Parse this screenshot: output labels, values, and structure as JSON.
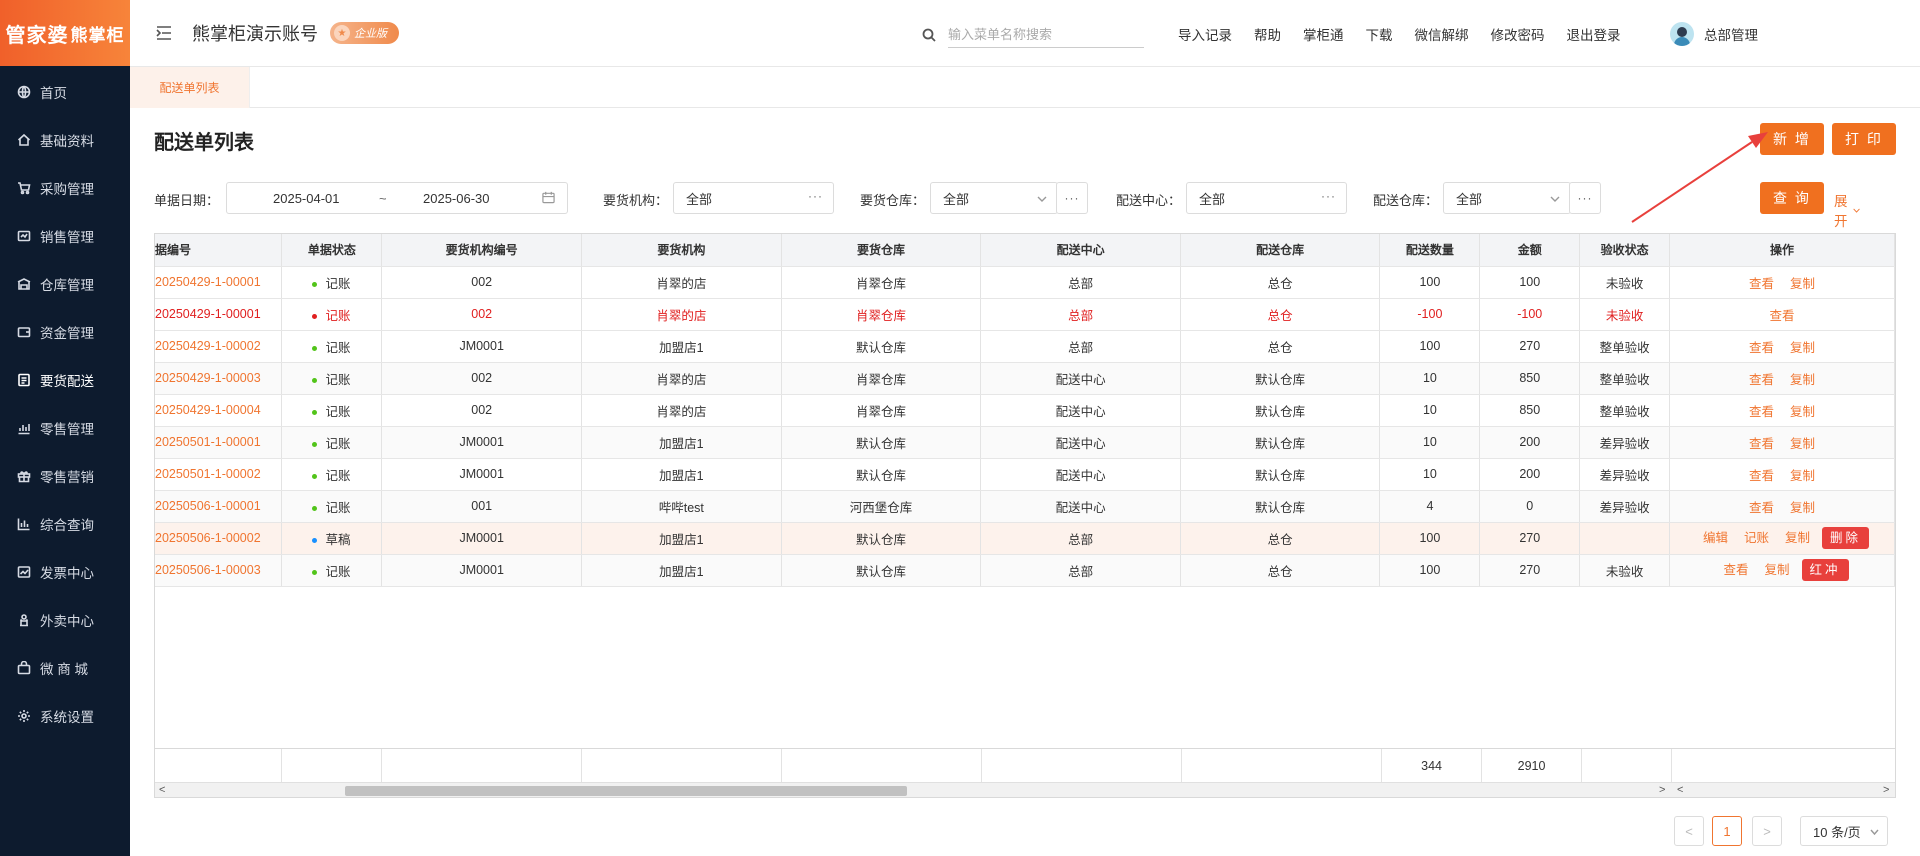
{
  "logo": {
    "text_a": "管家婆",
    "text_b": "熊掌柜"
  },
  "sidebar": {
    "items": [
      {
        "label": "首页",
        "icon": "globe-icon"
      },
      {
        "label": "基础资料",
        "icon": "home-icon"
      },
      {
        "label": "采购管理",
        "icon": "cart-icon"
      },
      {
        "label": "销售管理",
        "icon": "sales-icon"
      },
      {
        "label": "仓库管理",
        "icon": "warehouse-icon"
      },
      {
        "label": "资金管理",
        "icon": "wallet-icon"
      },
      {
        "label": "要货配送",
        "icon": "list-icon"
      },
      {
        "label": "零售管理",
        "icon": "chart-icon"
      },
      {
        "label": "零售营销",
        "icon": "gift-icon"
      },
      {
        "label": "综合查询",
        "icon": "bar-chart-icon"
      },
      {
        "label": "发票中心",
        "icon": "trend-icon"
      },
      {
        "label": "外卖中心",
        "icon": "bike-icon"
      },
      {
        "label": "微 商 城",
        "icon": "bag-icon"
      },
      {
        "label": "系统设置",
        "icon": "gear-icon"
      }
    ]
  },
  "header": {
    "account": "熊掌柜演示账号",
    "badge": "企业版",
    "search_placeholder": "输入菜单名称搜索",
    "links": [
      "导入记录",
      "帮助",
      "掌柜通",
      "下载",
      "微信解绑",
      "修改密码",
      "退出登录"
    ],
    "user": "总部管理"
  },
  "tab": {
    "label": "配送单列表"
  },
  "page": {
    "title": "配送单列表",
    "add_button": "新 增",
    "print_button": "打 印",
    "query_button": "查 询",
    "expand_label": "展开"
  },
  "filters": {
    "date_label": "单据日期：",
    "date_start": "2025-04-01",
    "date_sep": "~",
    "date_end": "2025-06-30",
    "org_label": "要货机构：",
    "org_value": "全部",
    "req_wh_label": "要货仓库：",
    "req_wh_value": "全部",
    "center_label": "配送中心：",
    "center_value": "全部",
    "dist_wh_label": "配送仓库：",
    "dist_wh_value": "全部"
  },
  "table": {
    "headers": [
      "据编号",
      "单据状态",
      "要货机构编号",
      "要货机构",
      "要货仓库",
      "配送中心",
      "配送仓库",
      "配送数量",
      "金额",
      "验收状态",
      "操作"
    ],
    "rows": [
      {
        "code": "20250429-1-00001",
        "status": "记账",
        "status_color": "#52c41a",
        "org_code": "002",
        "org": "肖翠的店",
        "req_wh": "肖翠仓库",
        "center": "总部",
        "dist_wh": "总仓",
        "qty": "100",
        "amount": "100",
        "check": "未验收",
        "ops": [
          "查看",
          "复制"
        ],
        "tag": ""
      },
      {
        "code": "20250429-1-00001",
        "status": "记账",
        "status_color": "#e02020",
        "org_code": "002",
        "org": "肖翠的店",
        "req_wh": "肖翠仓库",
        "center": "总部",
        "dist_wh": "总仓",
        "qty": "-100",
        "amount": "-100",
        "check": "未验收",
        "ops": [
          "查看"
        ],
        "tag": "",
        "red": true
      },
      {
        "code": "20250429-1-00002",
        "status": "记账",
        "status_color": "#52c41a",
        "org_code": "JM0001",
        "org": "加盟店1",
        "req_wh": "默认仓库",
        "center": "总部",
        "dist_wh": "总仓",
        "qty": "100",
        "amount": "270",
        "check": "整单验收",
        "ops": [
          "查看",
          "复制"
        ],
        "tag": ""
      },
      {
        "code": "20250429-1-00003",
        "status": "记账",
        "status_color": "#52c41a",
        "org_code": "002",
        "org": "肖翠的店",
        "req_wh": "肖翠仓库",
        "center": "配送中心",
        "dist_wh": "默认仓库",
        "qty": "10",
        "amount": "850",
        "check": "整单验收",
        "ops": [
          "查看",
          "复制"
        ],
        "tag": ""
      },
      {
        "code": "20250429-1-00004",
        "status": "记账",
        "status_color": "#52c41a",
        "org_code": "002",
        "org": "肖翠的店",
        "req_wh": "肖翠仓库",
        "center": "配送中心",
        "dist_wh": "默认仓库",
        "qty": "10",
        "amount": "850",
        "check": "整单验收",
        "ops": [
          "查看",
          "复制"
        ],
        "tag": ""
      },
      {
        "code": "20250501-1-00001",
        "status": "记账",
        "status_color": "#52c41a",
        "org_code": "JM0001",
        "org": "加盟店1",
        "req_wh": "默认仓库",
        "center": "配送中心",
        "dist_wh": "默认仓库",
        "qty": "10",
        "amount": "200",
        "check": "差异验收",
        "ops": [
          "查看",
          "复制"
        ],
        "tag": ""
      },
      {
        "code": "20250501-1-00002",
        "status": "记账",
        "status_color": "#52c41a",
        "org_code": "JM0001",
        "org": "加盟店1",
        "req_wh": "默认仓库",
        "center": "配送中心",
        "dist_wh": "默认仓库",
        "qty": "10",
        "amount": "200",
        "check": "差异验收",
        "ops": [
          "查看",
          "复制"
        ],
        "tag": ""
      },
      {
        "code": "20250506-1-00001",
        "status": "记账",
        "status_color": "#52c41a",
        "org_code": "001",
        "org": "哔哔test",
        "req_wh": "河西堡仓库",
        "center": "配送中心",
        "dist_wh": "默认仓库",
        "qty": "4",
        "amount": "0",
        "check": "差异验收",
        "ops": [
          "查看",
          "复制"
        ],
        "tag": ""
      },
      {
        "code": "20250506-1-00002",
        "status": "草稿",
        "status_color": "#1890ff",
        "org_code": "JM0001",
        "org": "加盟店1",
        "req_wh": "默认仓库",
        "center": "总部",
        "dist_wh": "总仓",
        "qty": "100",
        "amount": "270",
        "check": "",
        "ops": [
          "编辑",
          "记账",
          "复制"
        ],
        "tag": "删除",
        "hl": true
      },
      {
        "code": "20250506-1-00003",
        "status": "记账",
        "status_color": "#52c41a",
        "org_code": "JM0001",
        "org": "加盟店1",
        "req_wh": "默认仓库",
        "center": "总部",
        "dist_wh": "总仓",
        "qty": "100",
        "amount": "270",
        "check": "未验收",
        "ops": [
          "查看",
          "复制"
        ],
        "tag": "红冲"
      }
    ],
    "totals": {
      "qty": "344",
      "amount": "2910"
    }
  },
  "pagination": {
    "prev": "<",
    "current": "1",
    "next": ">",
    "page_size": "10 条/页"
  },
  "colors": {
    "accent": "#f0701f",
    "sidebar_bg": "#0d1b2e",
    "danger": "#e8403c"
  }
}
